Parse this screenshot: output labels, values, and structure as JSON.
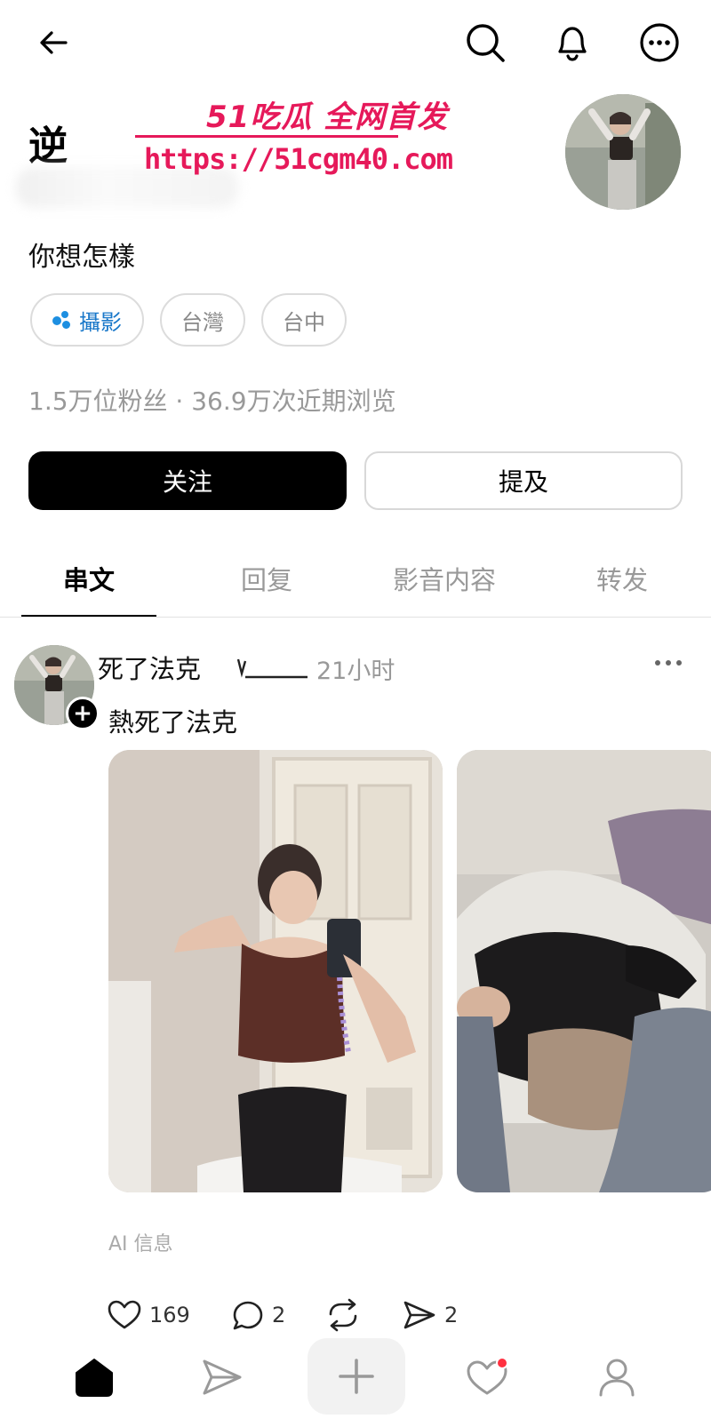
{
  "topbar": {
    "back": "back-arrow-icon",
    "search": "search-icon",
    "notifications": "bell-icon",
    "more": "more-circle-icon"
  },
  "profile": {
    "name": "逆",
    "bio": "你想怎樣",
    "chips": [
      {
        "label": "攝影",
        "primary": true
      },
      {
        "label": "台灣",
        "primary": false
      },
      {
        "label": "台中",
        "primary": false
      }
    ],
    "stats": "1.5万位粉丝 · 36.9万次近期浏览"
  },
  "watermark": {
    "title": "51吃瓜 全网首发",
    "url": "https://51cgm40.com",
    "color": "#e6195a"
  },
  "actions": {
    "follow": "关注",
    "mention": "提及"
  },
  "tabs": [
    {
      "label": "串文",
      "active": true
    },
    {
      "label": "回复",
      "active": false
    },
    {
      "label": "影音内容",
      "active": false
    },
    {
      "label": "转发",
      "active": false
    }
  ],
  "post": {
    "username": "死了法克",
    "time": "21小时",
    "text": "熱死了法克",
    "ai_info": "AI 信息",
    "likes": "169",
    "comments": "2",
    "shares": "2"
  },
  "bottom_nav": [
    "home-icon",
    "send-icon",
    "create-plus-icon",
    "activity-heart-icon",
    "profile-person-icon"
  ],
  "colors": {
    "accent_blue": "#1d8fe1",
    "notification_dot": "#ff3040"
  }
}
